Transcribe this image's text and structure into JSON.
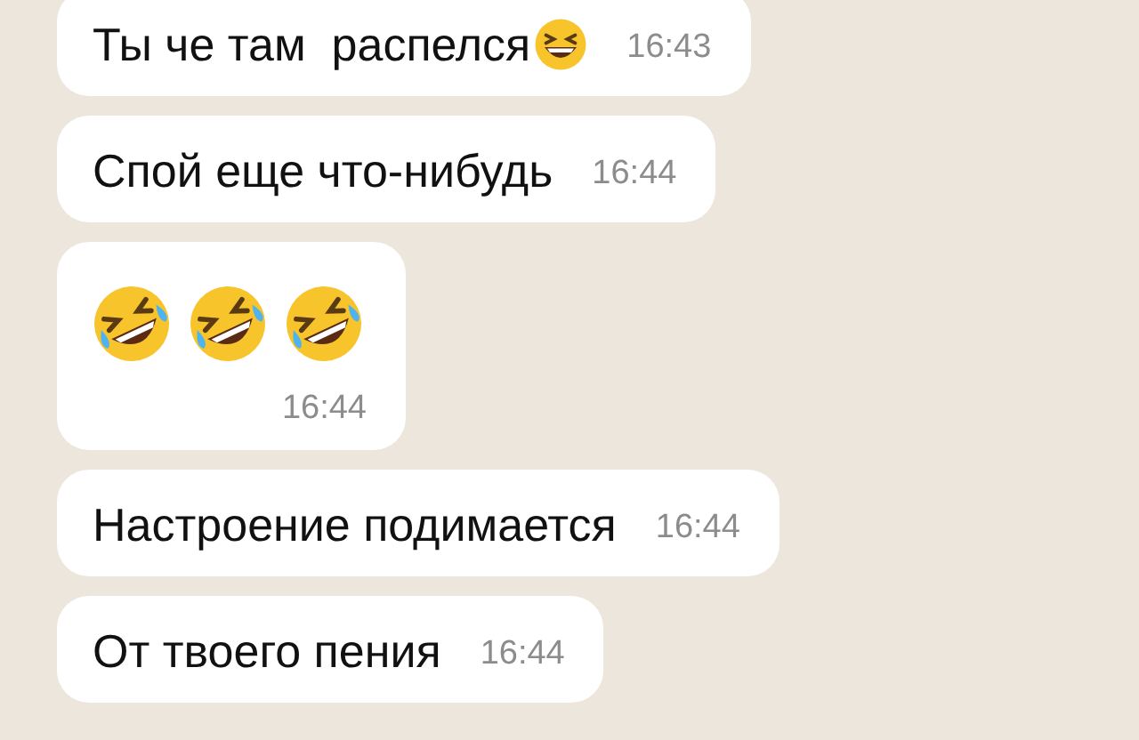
{
  "messages": [
    {
      "kind": "text",
      "text": "Ты че там  распелся",
      "trailing_emoji": true,
      "time": "16:43"
    },
    {
      "kind": "text",
      "text": "Спой еще что-нибудь",
      "trailing_emoji": false,
      "time": "16:44"
    },
    {
      "kind": "emoji",
      "time": "16:44"
    },
    {
      "kind": "text",
      "text": "Настроение подимается",
      "trailing_emoji": false,
      "time": "16:44"
    },
    {
      "kind": "text",
      "text": "От твоего пения",
      "trailing_emoji": false,
      "time": "16:44"
    }
  ]
}
